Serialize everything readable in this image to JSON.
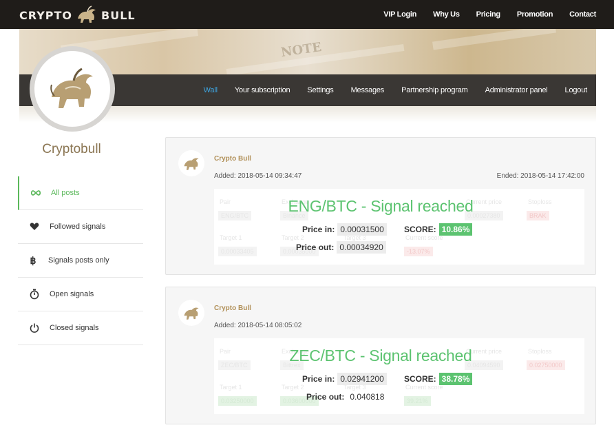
{
  "header": {
    "logo_left": "CRYPTO",
    "logo_right": "BULL",
    "nav": [
      "VIP Login",
      "Why Us",
      "Pricing",
      "Promotion",
      "Contact"
    ]
  },
  "banner": {
    "watermark": "NOTE"
  },
  "subnav": {
    "items": [
      "Wall",
      "Your subscription",
      "Settings",
      "Messages",
      "Partnership program",
      "Administrator panel",
      "Logout"
    ],
    "active": "Wall"
  },
  "profile": {
    "name": "Cryptobull"
  },
  "sidebar": {
    "items": [
      {
        "label": "All posts",
        "icon": "infinity-icon"
      },
      {
        "label": "Followed signals",
        "icon": "heart-icon"
      },
      {
        "label": "Signals posts only",
        "icon": "bitcoin-icon"
      },
      {
        "label": "Open signals",
        "icon": "stopwatch-icon"
      },
      {
        "label": "Closed signals",
        "icon": "power-icon"
      }
    ]
  },
  "posts": [
    {
      "author": "Crypto Bull",
      "added": "Added: 2018-05-14 09:34:47",
      "ended": "Ended: 2018-05-14 17:42:00",
      "headline": "ENG/BTC - Signal reached",
      "price_in_label": "Price in:",
      "price_in": "0.00031500",
      "score_label": "SCORE:",
      "score": "10.86%",
      "price_out_label": "Price out:",
      "price_out": "0.00034920",
      "ghost": {
        "pair_label": "Pair",
        "pair": "ENG/BTC",
        "exchange_label": "Exchange",
        "exchange": "Binance",
        "current_label": "Current price",
        "current": "0.00027380",
        "stoploss_label": "Stoploss",
        "stoploss": "BRAK",
        "t1_label": "Target 1",
        "t1": "0.00033405",
        "t2_label": "Target 2",
        "t2": "0.00035000",
        "t3_label": "Target 3",
        "score_label": "Current score",
        "score": "-13.07%"
      }
    },
    {
      "author": "Crypto Bull",
      "added": "Added: 2018-05-14 08:05:02",
      "ended": "",
      "headline": "ZEC/BTC - Signal reached",
      "price_in_label": "Price in:",
      "price_in": "0.02941200",
      "score_label": "SCORE:",
      "score": "38.78%",
      "price_out_label": "Price out:",
      "price_out": "0.040818",
      "ghost": {
        "pair_label": "Pair",
        "pair": "ZEC/BTC",
        "exchange_label": "Exchange",
        "exchange": "Bittrex",
        "current_label": "Current price",
        "current": "0.04094590",
        "stoploss_label": "Stoploss",
        "stoploss": "0.02750000",
        "t1_label": "Target 1",
        "t1": "0.03250000",
        "t2_label": "Target 2",
        "t2": "0.03600000",
        "t3_label": "Target 3",
        "score_label": "Current score",
        "score": "39.21%"
      }
    }
  ],
  "colors": {
    "accent_green": "#5cc370",
    "active_link": "#3ea5e0",
    "brand_gold": "#b19058",
    "topbar": "#1f1c19",
    "subnav": "#3a3734"
  }
}
